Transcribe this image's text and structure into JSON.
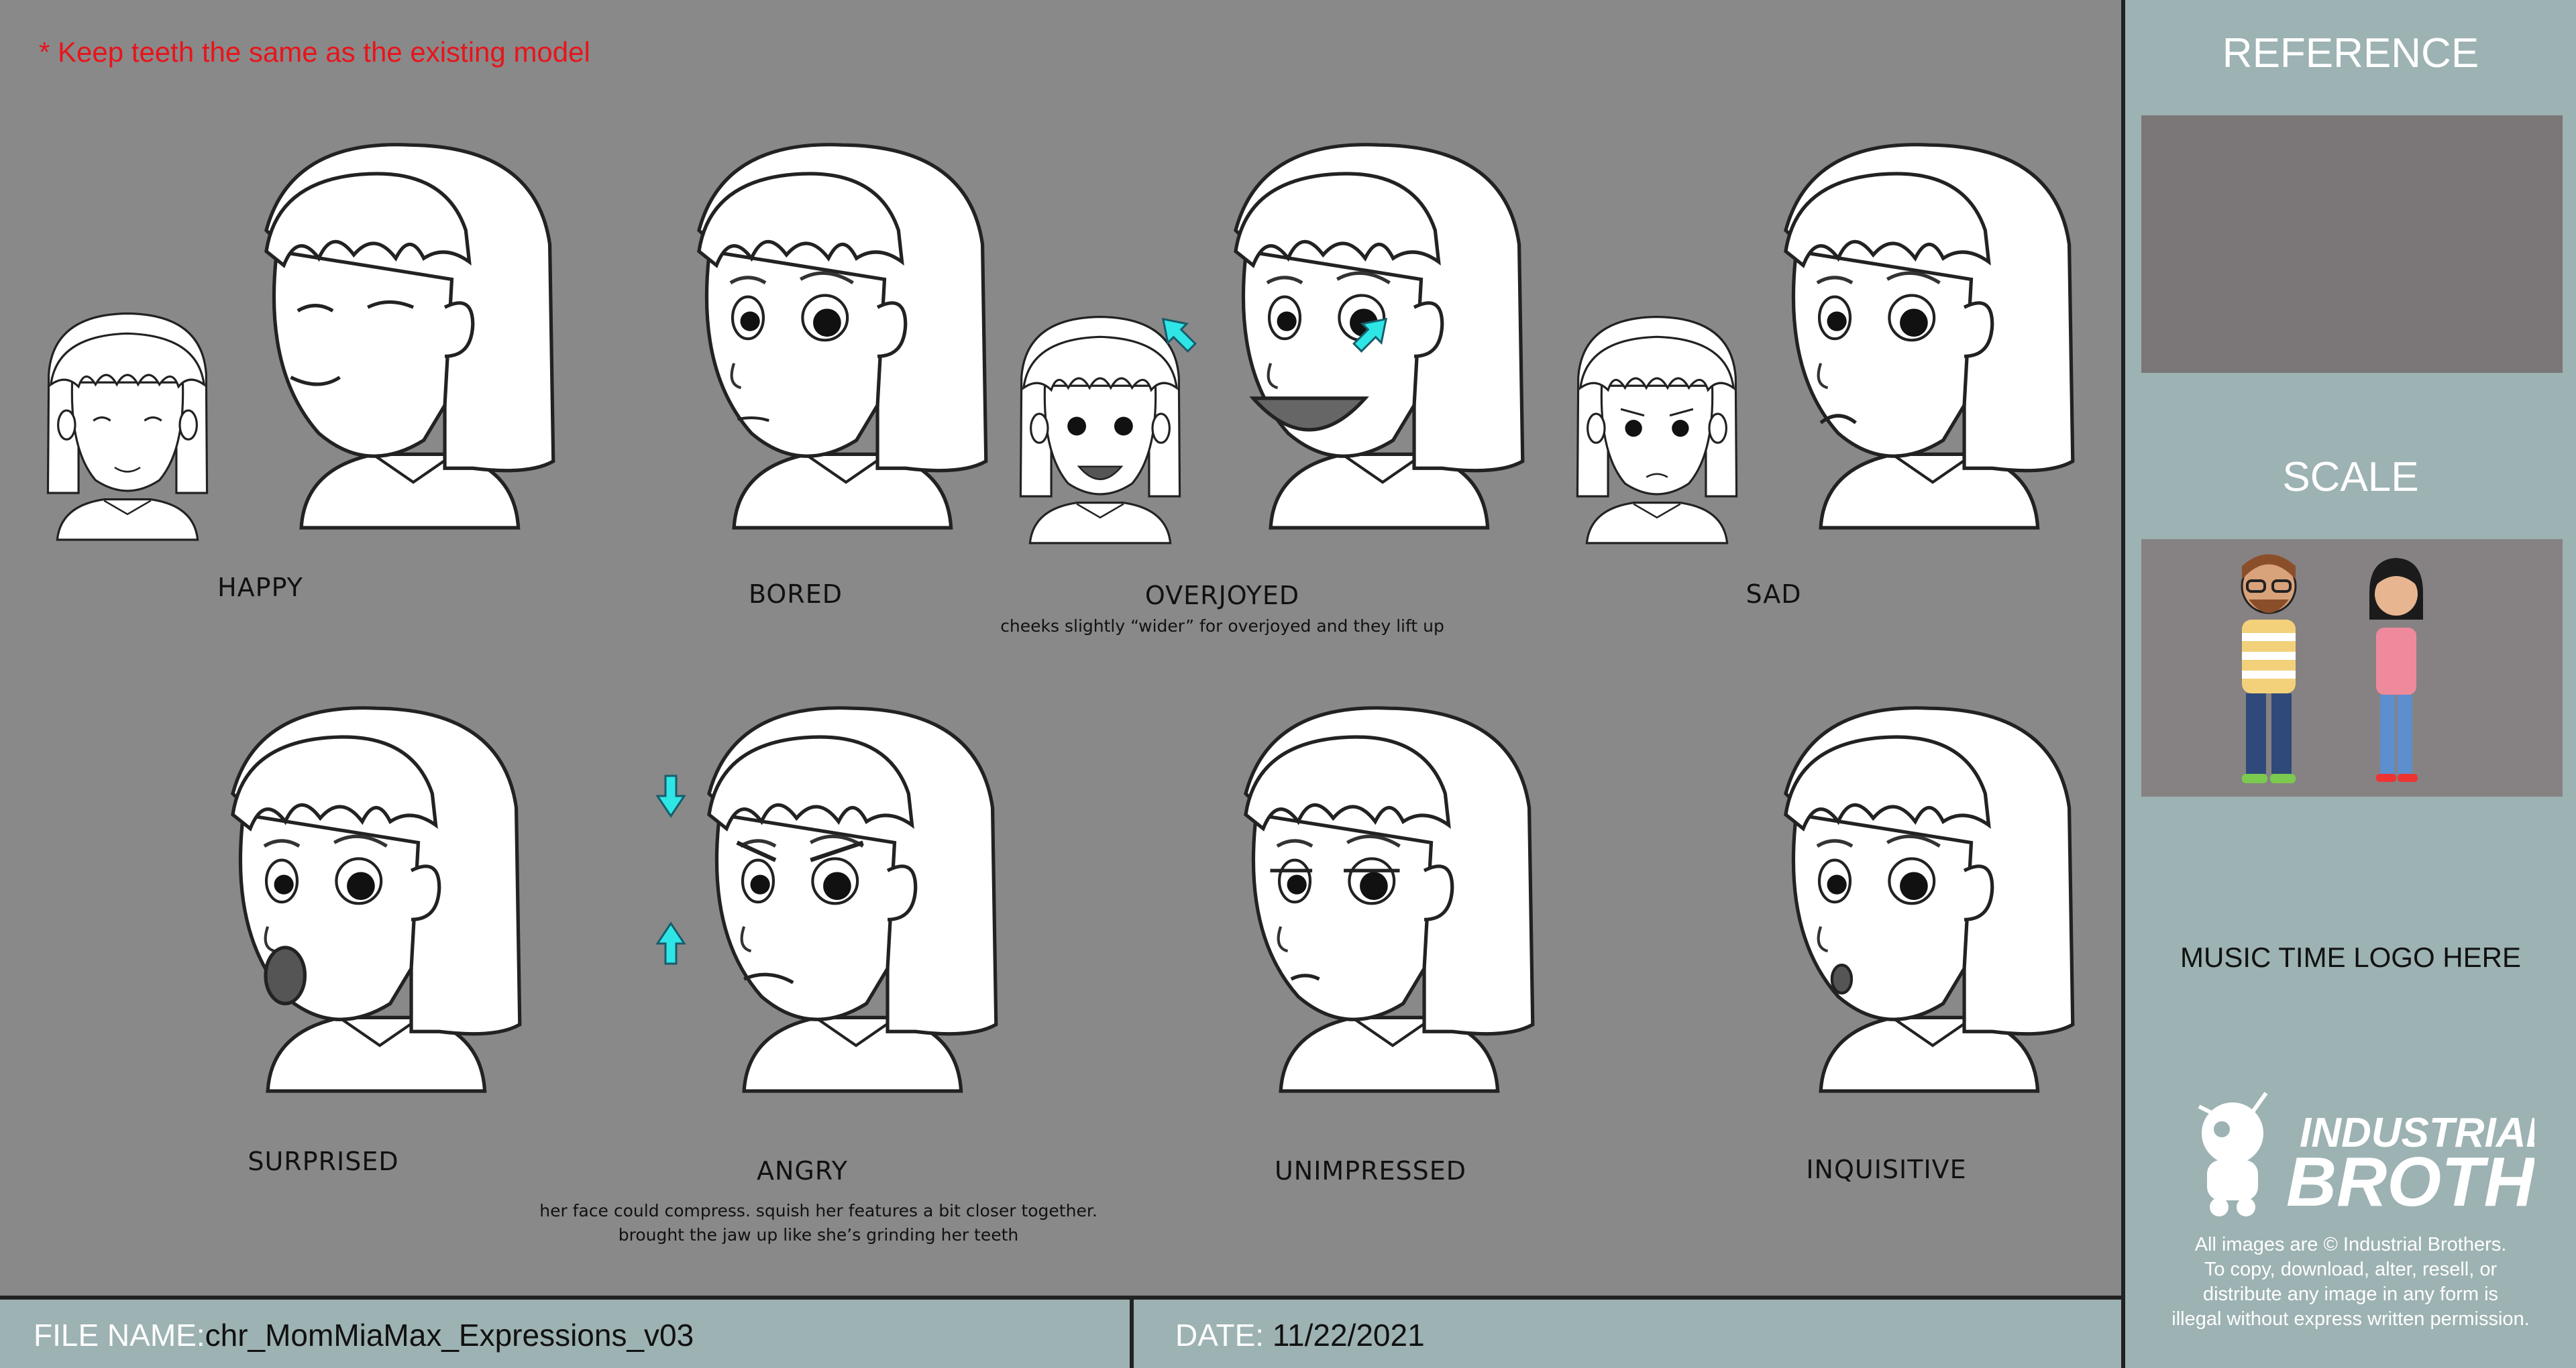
{
  "note": "* Keep teeth the same as the existing model",
  "expressions": [
    {
      "label": "HAPPY"
    },
    {
      "label": "BORED"
    },
    {
      "label": "OVERJOYED",
      "note": "cheeks slightly “wider” for overjoyed and they lift up"
    },
    {
      "label": "SAD"
    },
    {
      "label": "SURPRISED"
    },
    {
      "label": "ANGRY",
      "note_lines": [
        "her face could compress. squish her features a bit closer together.",
        "brought the jaw up like she’s grinding her teeth"
      ]
    },
    {
      "label": "UNIMPRESSED"
    },
    {
      "label": "INQUISITIVE"
    }
  ],
  "sidebar": {
    "reference_title": "REFERENCE",
    "scale_title": "SCALE",
    "logo_placeholder": "MUSIC TIME LOGO HERE",
    "brand_line1": "INDUSTRIAL",
    "brand_line2": "BROTHERS",
    "copyright_lines": [
      "All images are © Industrial Brothers.",
      "To copy, download, alter, resell, or",
      "distribute any image in any form is",
      "illegal without express written permission."
    ]
  },
  "footer": {
    "file_label": "FILE NAME:",
    "file_value": "chr_MomMiaMax_Expressions_v03",
    "date_label": "DATE:",
    "date_value": "11/22/2021"
  },
  "colors": {
    "background": "#898989",
    "sidebar": "#9db2b2",
    "note": "#e8141b",
    "arrow": "#2ee6e6"
  }
}
